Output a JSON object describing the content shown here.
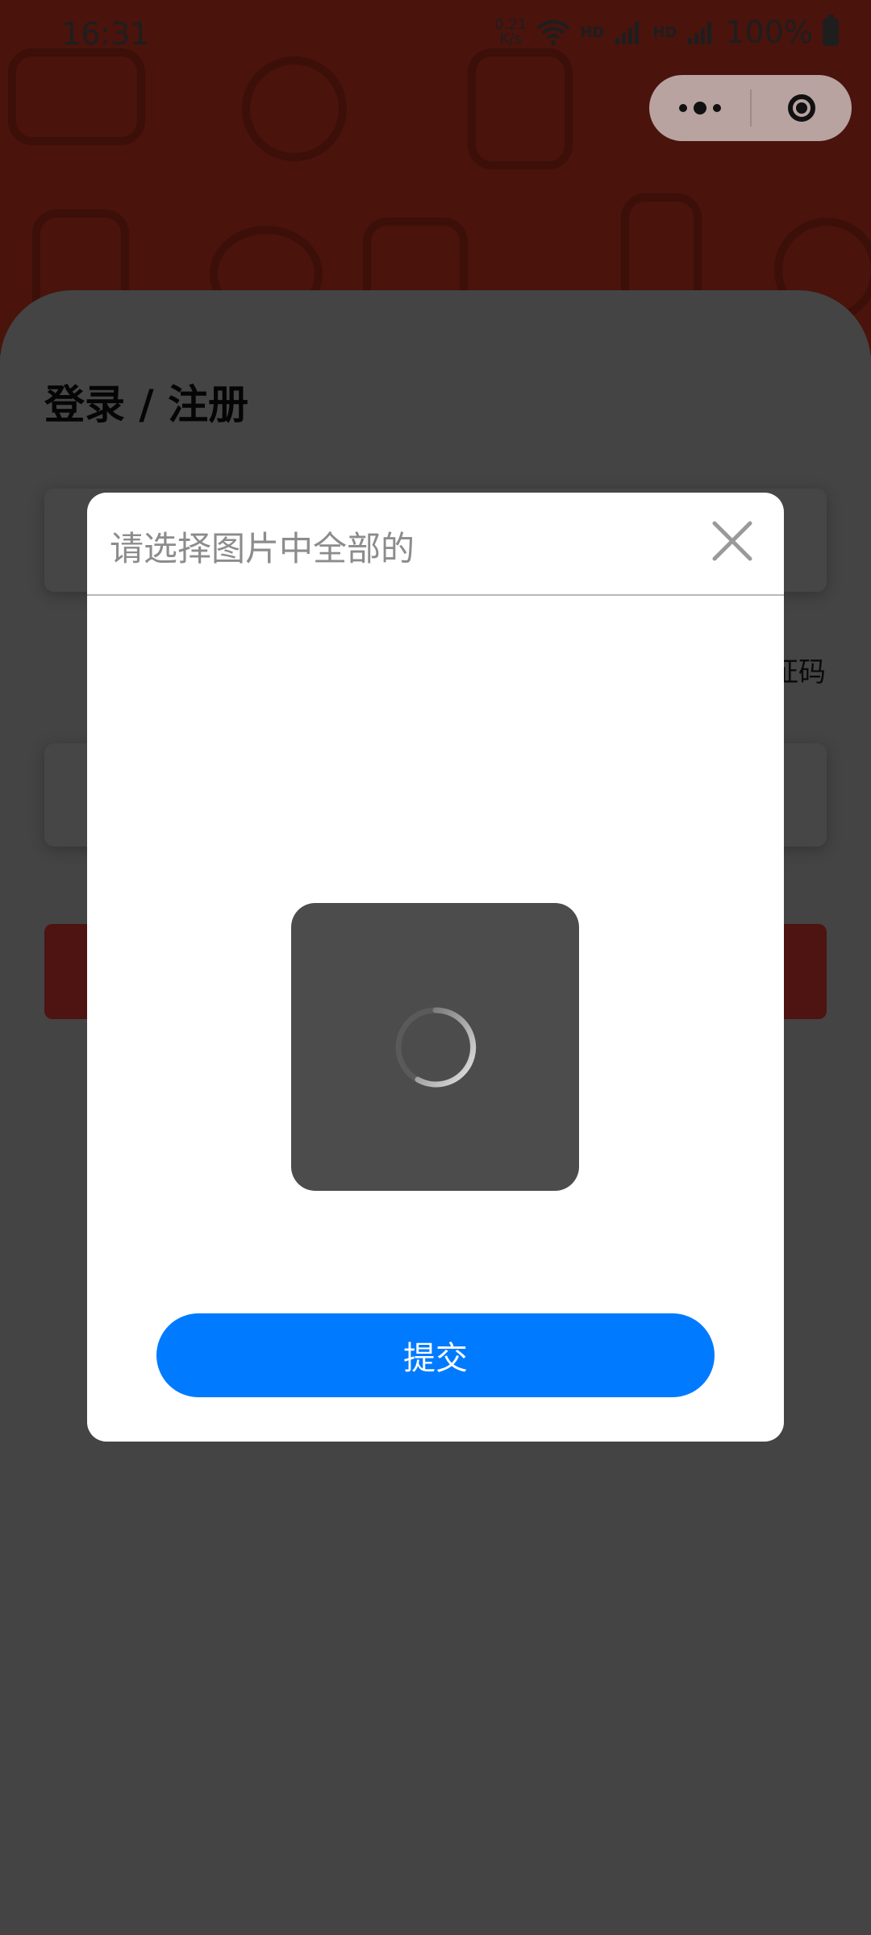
{
  "status_bar": {
    "time": "16:31",
    "net_speed_value": "0.21",
    "net_speed_unit": "K/s",
    "wifi_label": "6",
    "sim1_label": "HD",
    "sim1_tech": "5G",
    "sim2_label": "HD",
    "sim2_tech": "4G",
    "battery": "100%"
  },
  "capsule": {
    "more_icon": "more-dots-icon",
    "close_icon": "target-close-icon"
  },
  "login": {
    "title": "登录 / 注册",
    "get_code_partial": "证码"
  },
  "captcha_modal": {
    "title": "请选择图片中全部的",
    "close_icon": "close-icon",
    "loading_icon": "spinner-icon",
    "submit_label": "提交"
  },
  "colors": {
    "accent_blue": "#007aff",
    "banner_red_dimmed": "#4a130c",
    "overlay": "#3f3f3f"
  }
}
